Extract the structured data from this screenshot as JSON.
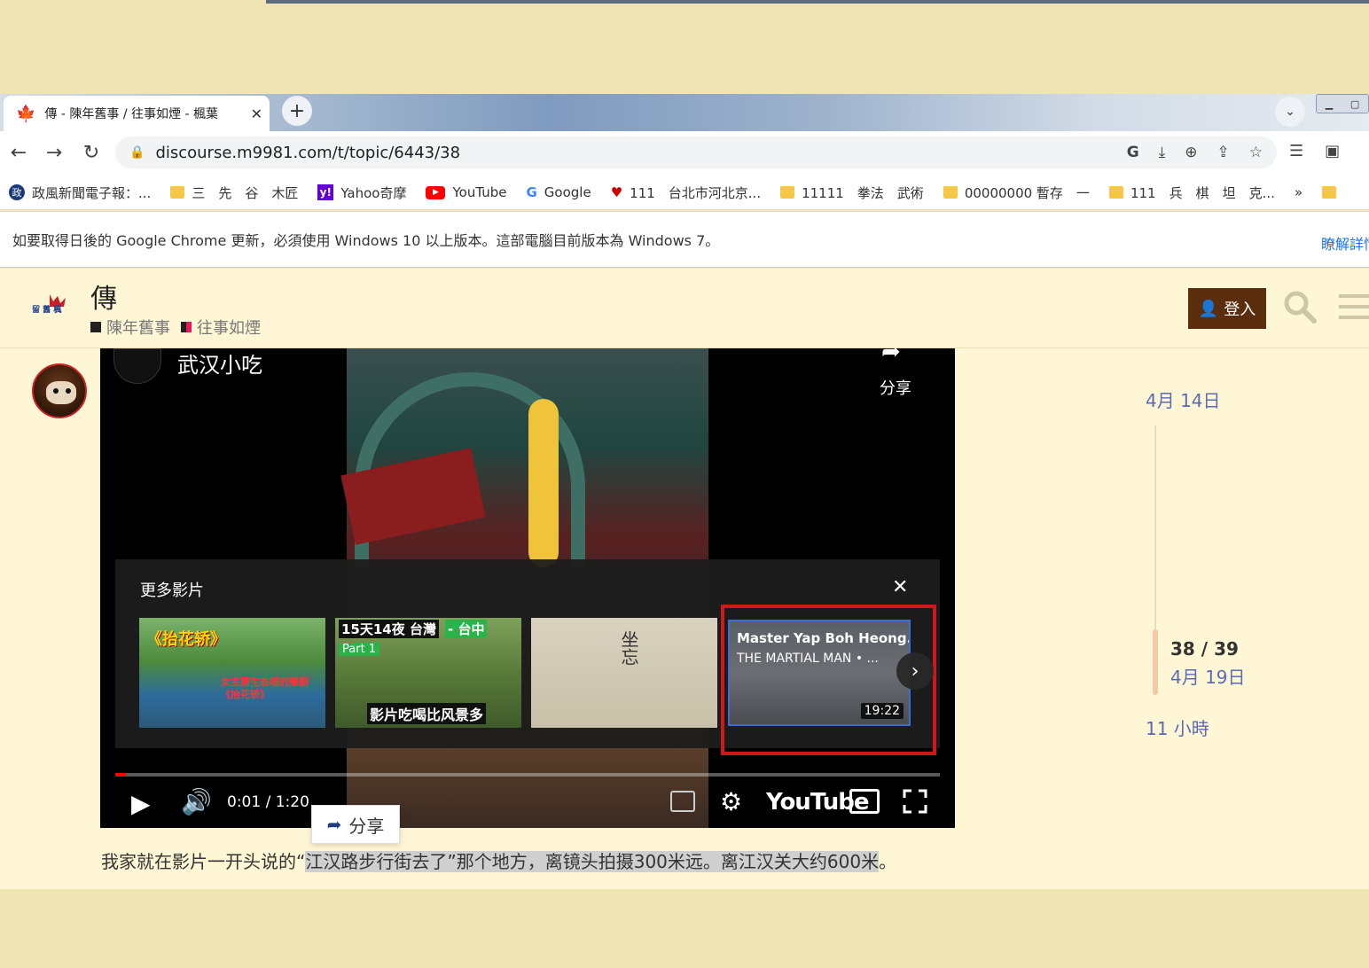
{
  "browser": {
    "tab_title": "傳 - 陳年舊事 / 往事如煙 - 楓葉",
    "url": "discourse.m9981.com/t/topic/6443/38",
    "bookmarks": [
      {
        "label": "政風新聞電子報：...",
        "icon": "zheng-icon"
      },
      {
        "label": "三　先　谷　木匠",
        "icon": "folder-icon"
      },
      {
        "label": "Yahoo奇摩",
        "icon": "yahoo-icon"
      },
      {
        "label": "YouTube",
        "icon": "youtube-icon"
      },
      {
        "label": "Google",
        "icon": "google-icon"
      },
      {
        "label": "111　台北市河北京...",
        "icon": "ptt-icon"
      },
      {
        "label": "11111　拳法　武術",
        "icon": "folder-icon"
      },
      {
        "label": "00000000 暫存　一",
        "icon": "folder-icon"
      },
      {
        "label": "111　兵　棋　坦　克...",
        "icon": "folder-icon"
      }
    ],
    "bookmarks_overflow": "»",
    "update_message": "如要取得日後的 Google Chrome 更新，必須使用 Windows 10 以上版本。這部電腦目前版本為 Windows 7。",
    "update_link": "瞭解詳情"
  },
  "site": {
    "topic_title": "傳",
    "categories": [
      {
        "label": "陳年舊事",
        "color": "#231f20"
      },
      {
        "label": "往事如煙",
        "color": "#e45735"
      }
    ],
    "login_label": "登入",
    "accent_color": "#5a2d0c"
  },
  "video": {
    "title": "武汉小吃",
    "share_label": "分享",
    "more_videos_title": "更多影片",
    "time": "0:01 / 1:20",
    "progress": 0.0125,
    "brand": "YouTube",
    "thumbnails": [
      {
        "title": "《抬花轿》",
        "subtitle": "女主原生态唱的豫剧《抬花轿》"
      },
      {
        "title": "15天14夜 台灣",
        "accent": "- 台中",
        "part": "Part 1",
        "bottom": "影片吃喝比风景多"
      },
      {
        "title": "坐忘"
      },
      {
        "title": "Master Yap Boh Heong...",
        "subtitle": "THE MARTIAL MAN • ...",
        "duration": "19:22"
      }
    ]
  },
  "share_popup": {
    "label": "分享"
  },
  "post": {
    "text_before": "我家就在影片一开头说的“",
    "text_selected": "江汉路步行街去了”那个地方，离镜头拍摄300米远。离江汉关大约600米",
    "text_after": "。"
  },
  "timeline": {
    "start": "4月 14日",
    "position": "38 / 39",
    "position_date": "4月 19日",
    "end": "11 小時"
  }
}
